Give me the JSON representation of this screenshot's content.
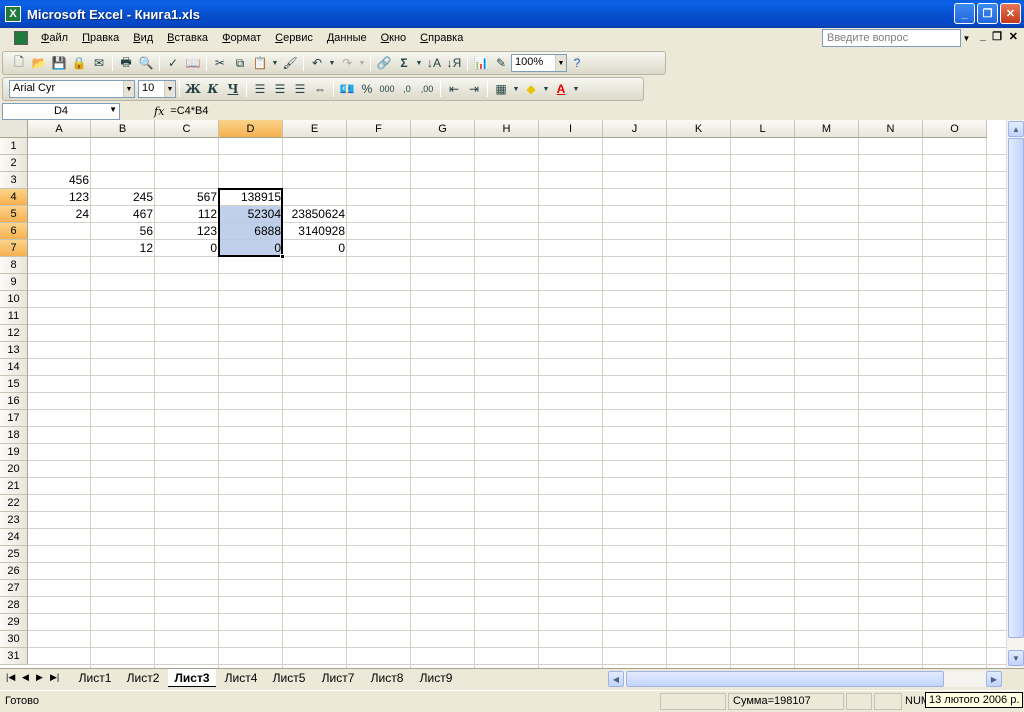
{
  "window": {
    "title": "Microsoft Excel - Книга1.xls"
  },
  "menu": {
    "items": [
      "Файл",
      "Правка",
      "Вид",
      "Вставка",
      "Формат",
      "Сервис",
      "Данные",
      "Окно",
      "Справка"
    ],
    "help_placeholder": "Введите вопрос"
  },
  "toolbar": {
    "zoom": "100%",
    "font_name": "Arial Cyr",
    "font_size": "10",
    "bold_label": "Ж",
    "italic_label": "К",
    "underline_label": "Ч",
    "percent_label": "%",
    "thousands_label": "000",
    "inc_decimal_label": ",0",
    "dec_decimal_label": ",00"
  },
  "formula": {
    "name_box": "D4",
    "fx_label": "fx",
    "content": "=C4*B4"
  },
  "sheet": {
    "columns": [
      "A",
      "B",
      "C",
      "D",
      "E",
      "F",
      "G",
      "H",
      "I",
      "J",
      "K",
      "L",
      "M",
      "N",
      "O"
    ],
    "selected_column": "D",
    "selected_rows": [
      4,
      5,
      6,
      7
    ],
    "rows": [
      "1",
      "2",
      "3",
      "4",
      "5",
      "6",
      "7",
      "8",
      "9",
      "10",
      "11",
      "12",
      "13",
      "14",
      "15",
      "16",
      "17",
      "18",
      "19",
      "20",
      "21",
      "22",
      "23",
      "24",
      "25",
      "26",
      "27",
      "28",
      "29",
      "30",
      "31"
    ],
    "cells": {
      "A3": "456",
      "A4": "123",
      "B4": "245",
      "C4": "567",
      "D4": "138915",
      "A5": "24",
      "B5": "467",
      "C5": "112",
      "D5": "52304",
      "E5": "23850624",
      "B6": "56",
      "C6": "123",
      "D6": "6888",
      "E6": "3140928",
      "B7": "12",
      "C7": "0",
      "D7": "0",
      "E7": "0"
    }
  },
  "tabs": [
    "Лист1",
    "Лист2",
    "Лист3",
    "Лист4",
    "Лист5",
    "Лист7",
    "Лист8",
    "Лист9"
  ],
  "active_tab": "Лист3",
  "status": {
    "ready": "Готово",
    "sum": "Сумма=198107",
    "num": "NUM",
    "date_tooltip": "13 лютого 2006 р."
  }
}
